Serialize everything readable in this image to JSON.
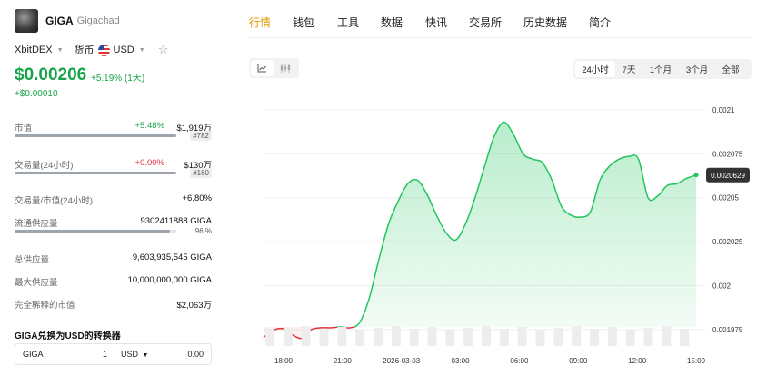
{
  "coin": {
    "symbol": "GIGA",
    "name": "Gigachad",
    "logo_icon": "gigachad-avatar-icon"
  },
  "selectors": {
    "exchange": "XbitDEX",
    "currency_label": "货币",
    "currency": "USD",
    "favorite_icon": "star-icon"
  },
  "price": {
    "value": "$0.00206",
    "change": "+5.19% (1天)",
    "change_abs": "+$0.00010"
  },
  "stats": {
    "market_cap": {
      "label": "市值",
      "change": "+5.48%",
      "value": "$1,919万",
      "rank": "#782"
    },
    "volume_24h": {
      "label": "交易量(24小时)",
      "change": "+0.00%",
      "value": "$130万",
      "rank": "#160"
    },
    "vol_to_mcap": {
      "label": "交易量/市值(24小时)",
      "value": "+6.80%"
    },
    "circulating": {
      "label": "流通供应量",
      "value": "9302411888 GIGA",
      "percent_text": "96 %",
      "percent": 96
    },
    "total_supply": {
      "label": "总供应量",
      "value": "9,603,935,545 GIGA"
    },
    "max_supply": {
      "label": "最大供应量",
      "value": "10,000,000,000 GIGA"
    },
    "fdv": {
      "label": "完全稀释的市值",
      "value": "$2,063万"
    }
  },
  "converter": {
    "title": "GIGA兑换为USD的转换器",
    "from_symbol": "GIGA",
    "from_amount": "1",
    "to_symbol": "USD",
    "to_amount": "0.00"
  },
  "tabs": [
    "行情",
    "钱包",
    "工具",
    "数据",
    "快讯",
    "交易所",
    "历史数据",
    "简介"
  ],
  "active_tab": "行情",
  "chart_type_buttons": [
    "line-chart-icon",
    "candlestick-icon"
  ],
  "time_ranges": [
    "24小时",
    "7天",
    "1个月",
    "3个月",
    "全部"
  ],
  "active_range": "24小时",
  "colors": {
    "accent": "#e39a00",
    "up": "#16a34a",
    "down": "#e0303a",
    "line": "#22c55e"
  },
  "chart_data": {
    "type": "area",
    "x": [
      "17:00",
      "17:30",
      "18:00",
      "18:30",
      "19:00",
      "19:30",
      "20:00",
      "20:30",
      "21:00",
      "21:30",
      "22:00",
      "22:30",
      "23:00",
      "23:30",
      "00:00",
      "00:30",
      "01:00",
      "01:30",
      "02:00",
      "02:30",
      "03:00",
      "03:30",
      "04:00",
      "04:30",
      "05:00",
      "05:30",
      "06:00",
      "06:30",
      "07:00",
      "07:30",
      "08:00",
      "08:30",
      "09:00",
      "09:30",
      "10:00",
      "10:30",
      "11:00",
      "11:30",
      "12:00",
      "12:30",
      "13:00",
      "13:30",
      "14:00",
      "14:30",
      "15:00",
      "15:15"
    ],
    "values": [
      0.0019705,
      0.0019745,
      0.0019755,
      0.001972,
      0.00197,
      0.001975,
      0.001976,
      0.001976,
      0.0019765,
      0.001976,
      0.001979,
      0.001993,
      0.002015,
      0.002035,
      0.002048,
      0.002058,
      0.00206,
      0.002052,
      0.00204,
      0.00203,
      0.002026,
      0.002035,
      0.00205,
      0.002068,
      0.002085,
      0.002093,
      0.002086,
      0.002075,
      0.002072,
      0.00207,
      0.00206,
      0.002045,
      0.00204,
      0.002039,
      0.002042,
      0.00206,
      0.002068,
      0.002072,
      0.0020735,
      0.002072,
      0.00205,
      0.002051,
      0.002057,
      0.002058,
      0.002061,
      0.0020629
    ],
    "reference_value": 0.0019765,
    "last_value_label": "0.0020629",
    "ylim": [
      0.0019925,
      0.0021
    ],
    "y_ticks": [
      "0.0021",
      "0.002075",
      "0.00205",
      "0.002025",
      "0.002",
      "0.001975"
    ],
    "x_ticks": [
      "18:00",
      "21:00",
      "2026-03-03",
      "03:00",
      "06:00",
      "09:00",
      "12:00",
      "15:00"
    ],
    "volume": "bars",
    "grid": true
  }
}
